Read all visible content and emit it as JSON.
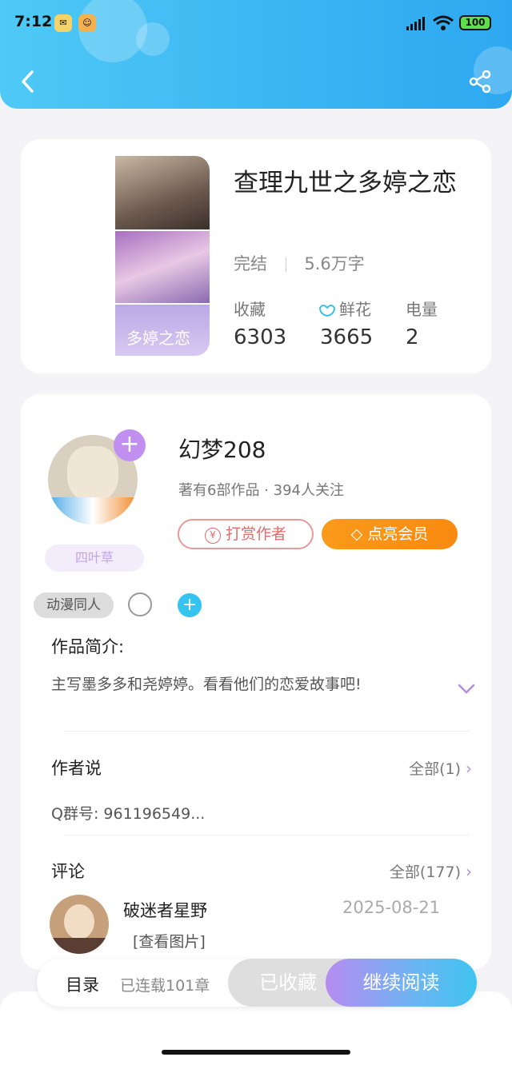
{
  "status_bar": {
    "time": "7:12",
    "battery": "100"
  },
  "book": {
    "title": "查理九世之多婷之恋",
    "status": "完结",
    "word_count": "5.6万字",
    "stats": [
      {
        "label": "收藏",
        "value": "6303"
      },
      {
        "label": "鲜花",
        "value": "3665"
      },
      {
        "label": "电量",
        "value": "2"
      }
    ],
    "cover_text": "多婷之恋"
  },
  "author": {
    "name": "幻梦208",
    "meta": "著有6部作品 · 394人关注",
    "badge": "四叶草",
    "reward_label": "打赏作者",
    "vip_label": "点亮会员"
  },
  "tags": {
    "genre": "动漫同人"
  },
  "intro": {
    "title": "作品简介:",
    "text": "主写墨多多和尧婷婷。看看他们的恋爱故事吧!"
  },
  "author_says": {
    "title": "作者说",
    "more": "全部(1)",
    "text": "Q群号: 961196549..."
  },
  "comments": {
    "title": "评论",
    "more": "全部(177)",
    "items": [
      {
        "user": "破迷者星野",
        "date": "2025-08-21",
        "content": "[查看图片]"
      }
    ]
  },
  "bottom_bar": {
    "toc": "目录",
    "serial": "已连载101章",
    "favorited": "已收藏",
    "continue": "继续阅读"
  },
  "colors": {
    "header_blue": "#3ab4f2",
    "accent_purple": "#b58ee0",
    "vip_orange": "#fb9a1a",
    "reward_red": "#e06b6b"
  }
}
